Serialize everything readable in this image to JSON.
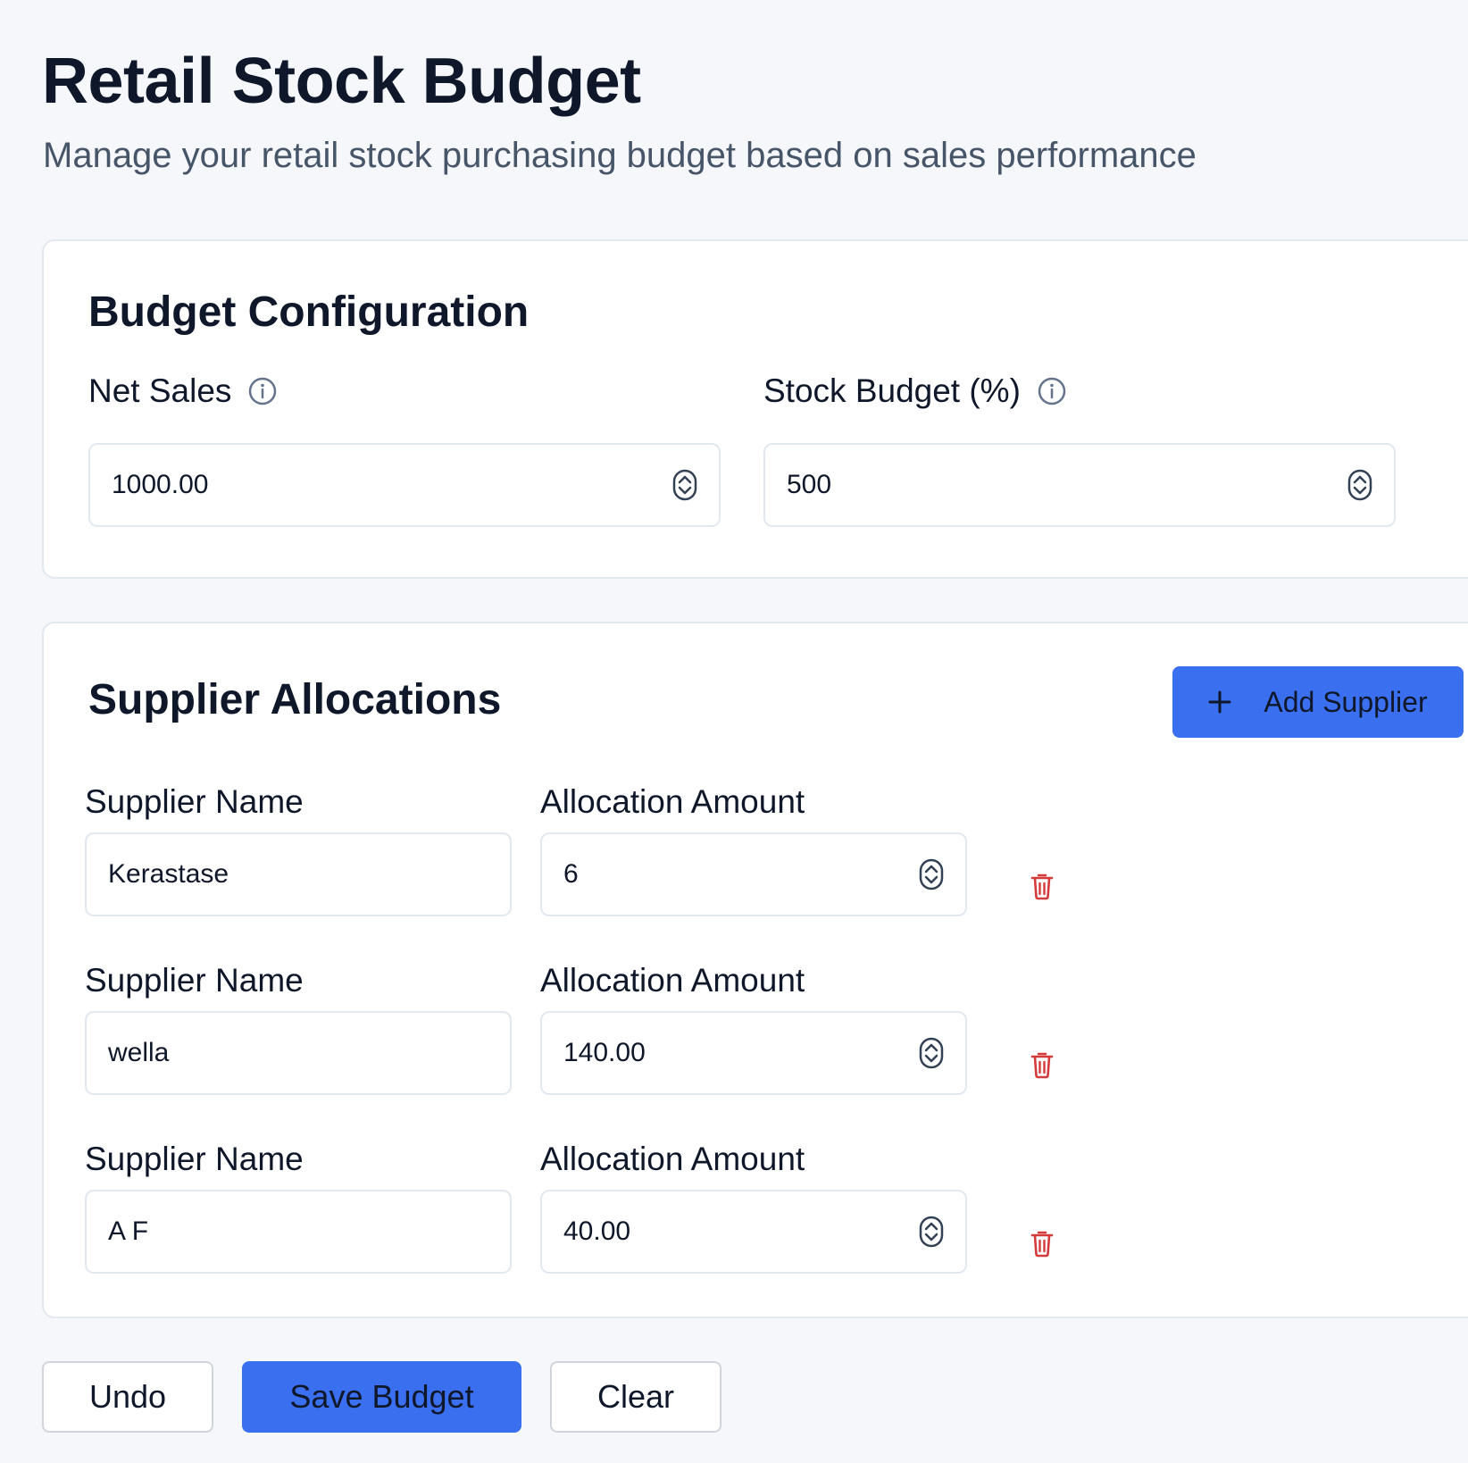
{
  "header": {
    "title": "Retail Stock Budget",
    "subtitle": "Manage your retail stock purchasing budget based on sales performance"
  },
  "config": {
    "title": "Budget Configuration",
    "net_sales_label": "Net Sales",
    "net_sales_value": "1000.00",
    "stock_budget_label": "Stock Budget (%)",
    "stock_budget_value": "500"
  },
  "suppliers": {
    "title": "Supplier Allocations",
    "add_label": "Add Supplier",
    "name_label": "Supplier Name",
    "amount_label": "Allocation Amount",
    "rows": [
      {
        "name": "Kerastase",
        "amount": "6"
      },
      {
        "name": "wella",
        "amount": "140.00"
      },
      {
        "name": "A F",
        "amount": "40.00"
      }
    ]
  },
  "actions": {
    "undo": "Undo",
    "save": "Save Budget",
    "clear": "Clear"
  },
  "colors": {
    "accent": "#3a6ff0",
    "danger": "#d43a3a",
    "background": "#f5f7fa"
  },
  "icons": {
    "info": "info-icon",
    "spinner": "number-spinner-icon",
    "plus": "plus-icon",
    "trash": "trash-icon"
  }
}
